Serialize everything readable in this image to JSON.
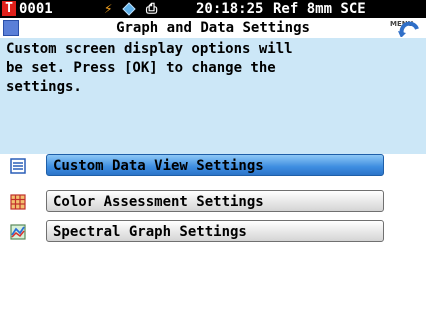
{
  "status_bar": {
    "sample_no": "0001",
    "time": "20:18:25",
    "mode": "Ref 8mm SCE",
    "t_label": "T"
  },
  "title_bar": {
    "title": "Graph and Data Settings",
    "menu_back_label": "MENU"
  },
  "message": {
    "text": "Custom screen display options will\nbe set. Press [OK] to change the\nsettings."
  },
  "menu": {
    "items": [
      {
        "label": "Custom Data View Settings",
        "icon": "list-icon",
        "selected": true
      },
      {
        "label": "Color Assessment Settings",
        "icon": "grid-icon",
        "selected": false
      },
      {
        "label": "Spectral Graph Settings",
        "icon": "graph-icon",
        "selected": false
      }
    ]
  },
  "colors": {
    "accent": "#3d8de0",
    "message_bg": "#cce7f7",
    "status_bg": "#000000"
  }
}
